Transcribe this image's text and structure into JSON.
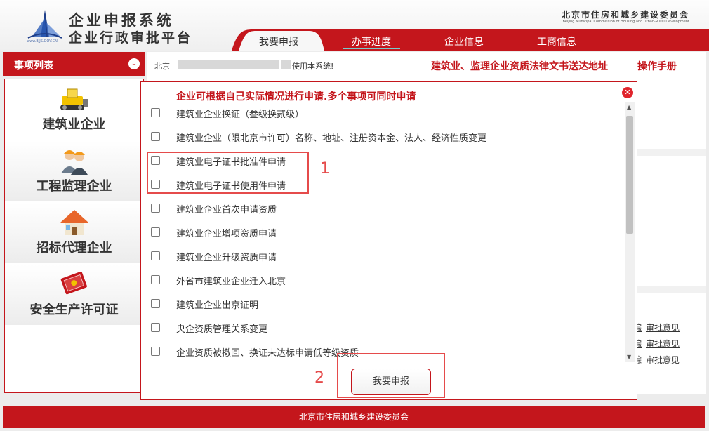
{
  "header": {
    "logo_caption": "www.BJJS.GOV.CN",
    "title": "企业申报系统",
    "subtitle": "企业行政审批平台",
    "org_cn": "北京市住房和城乡建设委员会",
    "org_en": "Beijing Municipal Commission of Housing and Urban-Rural Development"
  },
  "nav": {
    "tabs": [
      {
        "label": "我要申报",
        "active": true
      },
      {
        "label": "办事进度",
        "active": false
      },
      {
        "label": "企业信息",
        "active": false
      },
      {
        "label": "工商信息",
        "active": false
      }
    ]
  },
  "sidebar": {
    "header_label": "事项列表",
    "categories": [
      {
        "label": "建筑业企业",
        "icon": "bulldozer-icon"
      },
      {
        "label": "工程监理企业",
        "icon": "workers-icon"
      },
      {
        "label": "招标代理企业",
        "icon": "house-icon"
      },
      {
        "label": "安全生产许可证",
        "icon": "certificate-icon"
      }
    ]
  },
  "notice": {
    "prefix": "北京",
    "suffix": "使用本系统!"
  },
  "links": {
    "docs": "建筑业、监理企业资质法律文书送达地址",
    "manual": "操作手册"
  },
  "background_links": {
    "partial_left": "综",
    "opinion": "审批意见"
  },
  "modal": {
    "title": "企业可根据自己实际情况进行申请.多个事项可同时申请",
    "items": [
      "建筑业企业换证（叁级换贰级）",
      "建筑业企业（限北京市许可）名称、地址、注册资本金、法人、经济性质变更",
      "建筑业电子证书批准件申请",
      "建筑业电子证书使用件申请",
      "建筑业企业首次申请资质",
      "建筑业企业增项资质申请",
      "建筑业企业升级资质申请",
      "外省市建筑业企业迁入北京",
      "建筑业企业出京证明",
      "央企资质管理关系变更",
      "企业资质被撤回、换证未达标申请低等级资质"
    ],
    "submit_label": "我要申报"
  },
  "annotations": {
    "label_1": "1",
    "label_2": "2"
  },
  "footer": {
    "text": "北京市住房和城乡建设委员会"
  },
  "colors": {
    "brand_red": "#c4161c",
    "annotation_red": "#e54b4b"
  }
}
